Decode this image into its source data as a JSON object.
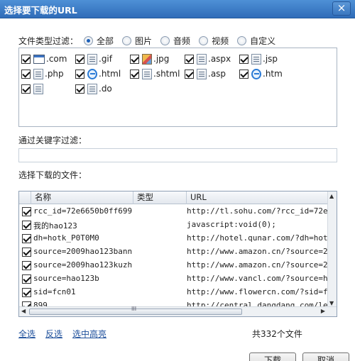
{
  "window": {
    "title": "选择要下载的URL",
    "close_glyph": "×"
  },
  "filter": {
    "label": "文件类型过滤：",
    "options": [
      {
        "label": "全部",
        "checked": true
      },
      {
        "label": "图片",
        "checked": false
      },
      {
        "label": "音频",
        "checked": false
      },
      {
        "label": "视频",
        "checked": false
      },
      {
        "label": "自定义",
        "checked": false
      }
    ]
  },
  "file_types": [
    {
      "ext": ".com",
      "icon": "window-icon",
      "checked": true
    },
    {
      "ext": ".gif",
      "icon": "document-icon",
      "checked": true
    },
    {
      "ext": ".jpg",
      "icon": "image-icon",
      "checked": true
    },
    {
      "ext": ".aspx",
      "icon": "document-icon",
      "checked": true
    },
    {
      "ext": ".jsp",
      "icon": "document-icon",
      "checked": true
    },
    {
      "ext": ".php",
      "icon": "document-icon",
      "checked": true
    },
    {
      "ext": ".html",
      "icon": "ie-icon",
      "checked": true
    },
    {
      "ext": ".shtml",
      "icon": "document-icon",
      "checked": true
    },
    {
      "ext": ".asp",
      "icon": "document-icon",
      "checked": true
    },
    {
      "ext": ".htm",
      "icon": "ie-icon",
      "checked": true
    },
    {
      "ext": "",
      "icon": "document-icon",
      "checked": true
    },
    {
      "ext": ".do",
      "icon": "document-icon",
      "checked": true
    }
  ],
  "keyword": {
    "label": "通过关键字过滤：",
    "value": ""
  },
  "downloads": {
    "label": "选择下载的文件：",
    "columns": [
      "名称",
      "类型",
      "URL"
    ],
    "rows": [
      {
        "name": "rcc_id=72e6650b0ff699",
        "type": "",
        "url": "http://tl.sohu.com/?rcc_id=72e"
      },
      {
        "name": "我的hao123",
        "type": "",
        "url": "javascript:void(0);"
      },
      {
        "name": "dh=hotk_P0T0M0",
        "type": "",
        "url": "http://hotel.qunar.com/?dh=hot"
      },
      {
        "name": "source=2009hao123bann",
        "type": "",
        "url": "http://www.amazon.cn/?source=2"
      },
      {
        "name": "source=2009hao123kuzh",
        "type": "",
        "url": "http://www.amazon.cn/?source=2"
      },
      {
        "name": "source=hao123b",
        "type": "",
        "url": "http://www.vancl.com/?source=h"
      },
      {
        "name": "sid=fcn01",
        "type": "",
        "url": "http://www.flowercn.com/?sid=f"
      },
      {
        "name": "899",
        "type": "",
        "url": "http://central.dangdang.com/le"
      }
    ],
    "scroll_grip": "III"
  },
  "actions": {
    "select_all": "全选",
    "invert": "反选",
    "select_highlighted": "选中高亮"
  },
  "count_text": "共332个文件",
  "buttons": {
    "download": "下载",
    "cancel": "取消"
  }
}
